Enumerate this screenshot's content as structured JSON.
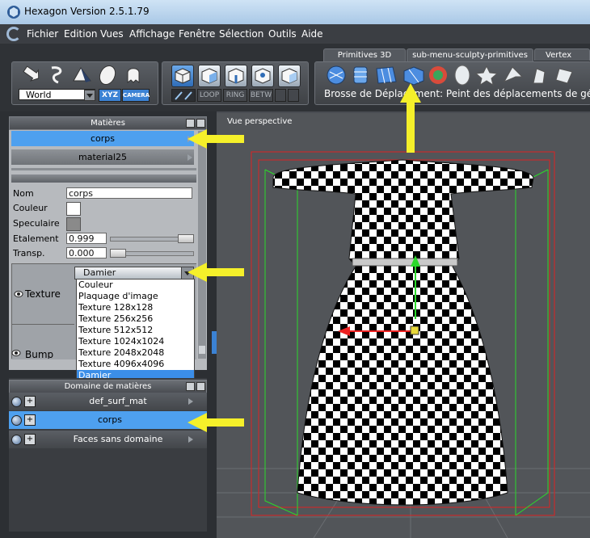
{
  "window": {
    "title": "Hexagon Version 2.5.1.79"
  },
  "menu": [
    "Fichier",
    "Edition",
    "Vues",
    "Affichage",
    "Fenêtre",
    "Sélection",
    "Outils",
    "Aide"
  ],
  "toolbar": {
    "coord_system": "World",
    "xyz": "XYZ",
    "camera": "CAMERA",
    "loop": "LOOP",
    "ring": "RING",
    "betw": "BETW",
    "tabs": [
      "Primitives 3D",
      "sub-menu-sculpty-primitives",
      "Vertex mod"
    ],
    "brush_text": "Brosse de Déplacement: Peint des déplacements de géom"
  },
  "materials": {
    "header": "Matières",
    "selected": "corps",
    "second": "material25",
    "fields": {
      "nom_label": "Nom",
      "nom_value": "corps",
      "couleur_label": "Couleur",
      "speculaire_label": "Speculaire",
      "etalement_label": "Etalement",
      "etalement_value": "0.999",
      "transp_label": "Transp.",
      "transp_value": "0.000",
      "etalement_level": 0.999,
      "transp_level": 0.0
    },
    "texture_label": "Texture",
    "bump_label": "Bump",
    "texture_selected": "Damier",
    "texture_options": [
      "Couleur",
      "Plaquage d'image",
      "Texture 128x128",
      "Texture 256x256",
      "Texture 512x512",
      "Texture 1024x1024",
      "Texture 2048x2048",
      "Texture 4096x4096",
      "Damier"
    ]
  },
  "domains": {
    "header": "Domaine de matières",
    "items": [
      "def_surf_mat",
      "corps",
      "Faces sans domaine"
    ],
    "selected_index": 1
  },
  "viewport": {
    "label": "Vue perspective"
  },
  "colors": {
    "accent": "#4ea0ef",
    "highlight_arrow": "#f5f02a"
  }
}
